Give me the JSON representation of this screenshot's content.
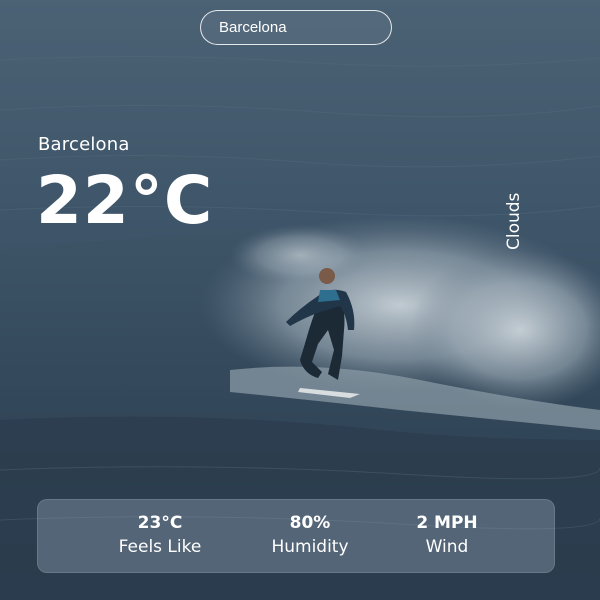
{
  "search": {
    "value": "Barcelona",
    "placeholder": "Barcelona"
  },
  "weather": {
    "city": "Barcelona",
    "temperature": "22°C",
    "condition": "Clouds"
  },
  "stats": [
    {
      "value": "23°C",
      "label": "Feels Like"
    },
    {
      "value": "80%",
      "label": "Humidity"
    },
    {
      "value": "2 MPH",
      "label": "Wind"
    }
  ],
  "colors": {
    "sea_dark": "#2f4152",
    "sea_mid": "#3e5468",
    "foam": "#b9c5cd",
    "text": "#ffffff"
  },
  "background": {
    "icon": "surfer-wave-photo"
  }
}
